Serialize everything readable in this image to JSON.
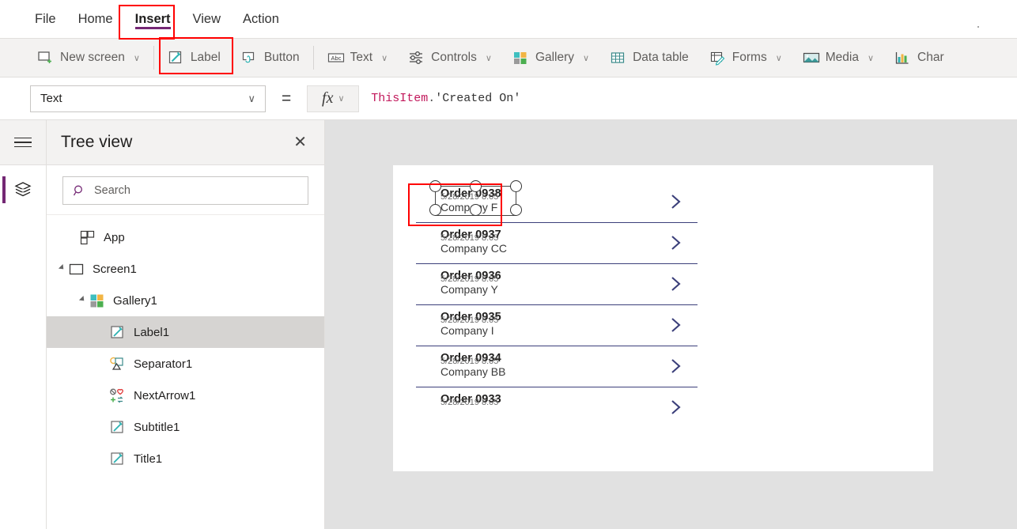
{
  "menu": {
    "tabs": [
      {
        "label": "File",
        "active": false
      },
      {
        "label": "Home",
        "active": false
      },
      {
        "label": "Insert",
        "active": true
      },
      {
        "label": "View",
        "active": false
      },
      {
        "label": "Action",
        "active": false
      }
    ]
  },
  "ribbon": {
    "items": [
      {
        "label": "New screen",
        "icon": "new-screen-icon",
        "caret": "∨"
      },
      {
        "label": "Label",
        "icon": "label-icon",
        "caret": ""
      },
      {
        "label": "Button",
        "icon": "button-icon",
        "caret": ""
      },
      {
        "label": "Text",
        "icon": "text-abc-icon",
        "caret": "∨"
      },
      {
        "label": "Controls",
        "icon": "controls-sliders-icon",
        "caret": "∨"
      },
      {
        "label": "Gallery",
        "icon": "gallery-squares-icon",
        "caret": "∨"
      },
      {
        "label": "Data table",
        "icon": "data-table-icon",
        "caret": ""
      },
      {
        "label": "Forms",
        "icon": "forms-icon",
        "caret": "∨"
      },
      {
        "label": "Media",
        "icon": "media-image-icon",
        "caret": "∨"
      },
      {
        "label": "Char",
        "icon": "charts-icon",
        "caret": ""
      }
    ]
  },
  "formula_bar": {
    "property": "Text",
    "property_caret": "∨",
    "equals": "=",
    "fx_label": "fx",
    "fx_caret": "∨",
    "formula_object": "ThisItem",
    "formula_dot": ".",
    "formula_field": "'Created On'"
  },
  "tree_panel": {
    "title": "Tree view",
    "close_label": "✕",
    "search_placeholder": "Search",
    "items": [
      {
        "label": "App",
        "indent": 0,
        "twisty": false,
        "icon": "app-icon",
        "selected": false
      },
      {
        "label": "Screen1",
        "indent": 0,
        "twisty": true,
        "icon": "screen-icon",
        "selected": false
      },
      {
        "label": "Gallery1",
        "indent": 1,
        "twisty": true,
        "icon": "gallery-squares-icon",
        "selected": false
      },
      {
        "label": "Label1",
        "indent": 2,
        "twisty": false,
        "icon": "label-pencil-icon",
        "selected": true
      },
      {
        "label": "Separator1",
        "indent": 2,
        "twisty": false,
        "icon": "separator-shapes-icon",
        "selected": false
      },
      {
        "label": "NextArrow1",
        "indent": 2,
        "twisty": false,
        "icon": "nextarrow-icons-icon",
        "selected": false
      },
      {
        "label": "Subtitle1",
        "indent": 2,
        "twisty": false,
        "icon": "label-pencil-icon",
        "selected": false
      },
      {
        "label": "Title1",
        "indent": 2,
        "twisty": false,
        "icon": "label-pencil-icon",
        "selected": false
      }
    ]
  },
  "canvas": {
    "gallery_rows": [
      {
        "title": "Order 0938",
        "date": "5/28/2019 8:05",
        "subtitle": "Company F",
        "selected": true,
        "clipped": false
      },
      {
        "title": "Order 0937",
        "date": "5/28/2019 8:05",
        "subtitle": "Company CC",
        "selected": false,
        "clipped": false
      },
      {
        "title": "Order 0936",
        "date": "5/28/2019 8:05",
        "subtitle": "Company Y",
        "selected": false,
        "clipped": false
      },
      {
        "title": "Order 0935",
        "date": "5/28/2019 8:05",
        "subtitle": "Company I",
        "selected": false,
        "clipped": false
      },
      {
        "title": "Order 0934",
        "date": "5/28/2019 8:05",
        "subtitle": "Company BB",
        "selected": false,
        "clipped": false
      },
      {
        "title": "Order 0933",
        "date": "5/28/2019 8:05",
        "subtitle": "",
        "selected": false,
        "clipped": true
      }
    ]
  },
  "colors": {
    "accent_purple": "#742774",
    "annotation_red": "#ff0000",
    "chevron_navy": "#3b3f7a",
    "ribbon_bg": "#f3f2f1",
    "canvas_bg": "#e1e1e1",
    "formula_pink": "#c2185b"
  }
}
